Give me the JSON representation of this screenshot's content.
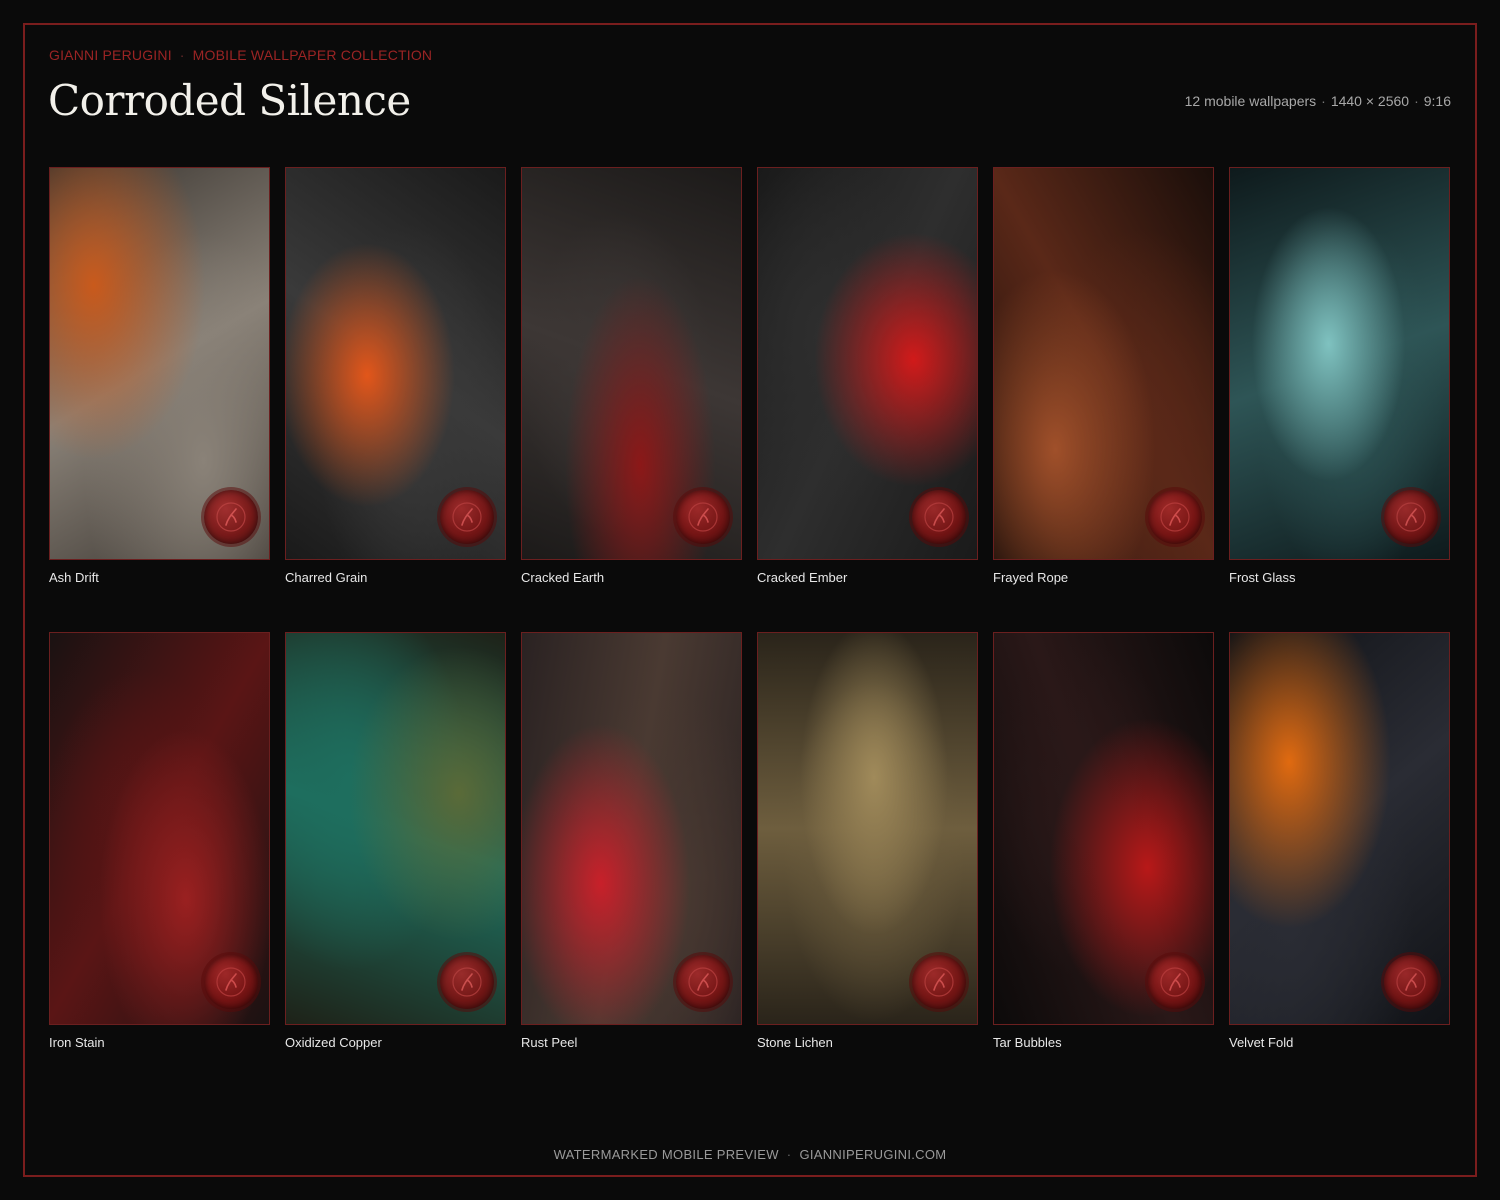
{
  "header": {
    "brand": "GIANNI PERUGINI",
    "collection": "MOBILE WALLPAPER COLLECTION",
    "title": "Corroded Silence",
    "count": "12 mobile wallpapers",
    "resolution": "1440 × 2560",
    "ratio": "9:16"
  },
  "wallpapers": [
    {
      "name": "Ash Drift",
      "colors": [
        "#3a3530",
        "#8a8278",
        "#c95a1c"
      ]
    },
    {
      "name": "Charred Grain",
      "colors": [
        "#1a1a1a",
        "#3a3a3a",
        "#e2561a"
      ]
    },
    {
      "name": "Cracked Earth",
      "colors": [
        "#1c1a19",
        "#3d3735",
        "#8c1818"
      ]
    },
    {
      "name": "Cracked Ember",
      "colors": [
        "#1a1a1a",
        "#2e2e2e",
        "#d11a1a"
      ]
    },
    {
      "name": "Frayed Rope",
      "colors": [
        "#1a0e0a",
        "#5a2818",
        "#a0502a"
      ]
    },
    {
      "name": "Frost Glass",
      "colors": [
        "#0e1a1c",
        "#2e5556",
        "#7fc2c0"
      ]
    },
    {
      "name": "Iron Stain",
      "colors": [
        "#1a1212",
        "#5a1515",
        "#9a2020"
      ]
    },
    {
      "name": "Oxidized Copper",
      "colors": [
        "#1e2218",
        "#1e6e5e",
        "#5a6a38"
      ]
    },
    {
      "name": "Rust Peel",
      "colors": [
        "#2a2222",
        "#4a3a32",
        "#c8202a"
      ]
    },
    {
      "name": "Stone Lichen",
      "colors": [
        "#2a241a",
        "#6e5e3e",
        "#a08a5a"
      ]
    },
    {
      "name": "Tar Bubbles",
      "colors": [
        "#0c0a0a",
        "#2a1818",
        "#b81818"
      ]
    },
    {
      "name": "Velvet Fold",
      "colors": [
        "#101216",
        "#2a2c34",
        "#e06a10"
      ]
    }
  ],
  "footer": {
    "label": "WATERMARKED MOBILE PREVIEW",
    "site": "GIANNIPERUGINI.COM"
  }
}
